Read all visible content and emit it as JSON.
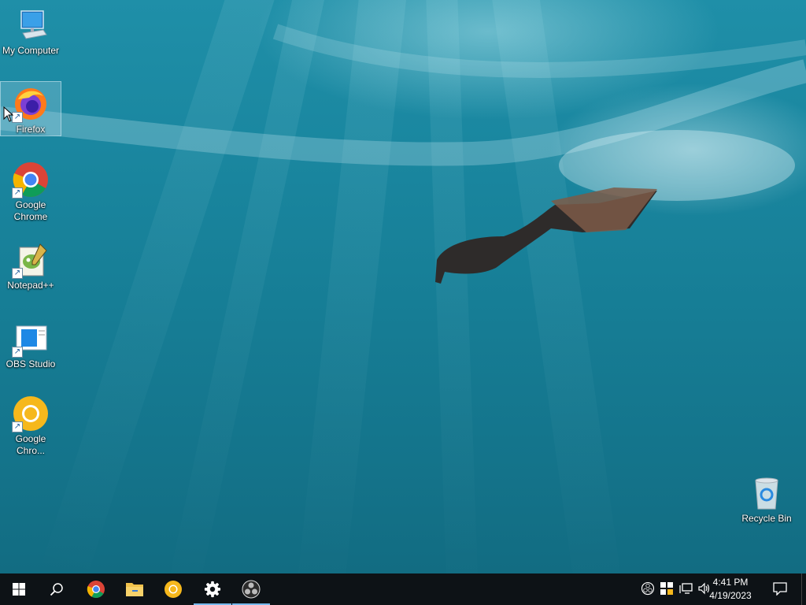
{
  "desktop": {
    "icons": [
      {
        "label": "My Computer"
      },
      {
        "label": "Firefox"
      },
      {
        "label": "Google Chrome"
      },
      {
        "label": "Notepad++"
      },
      {
        "label": "OBS Studio"
      },
      {
        "label": "Google Chro..."
      },
      {
        "label": "Recycle Bin"
      }
    ]
  },
  "taskbar": {
    "buttons": [
      {
        "icon": "windows-start-icon"
      },
      {
        "icon": "search-icon"
      },
      {
        "icon": "chrome-icon"
      },
      {
        "icon": "file-explorer-icon"
      },
      {
        "icon": "chrome-canary-icon"
      },
      {
        "icon": "settings-gear-icon"
      },
      {
        "icon": "obs-studio-icon"
      }
    ],
    "tray": {
      "time": "4:41 PM",
      "date": "4/19/2023"
    }
  },
  "colors": {
    "accent": "#76b9ed",
    "taskbar": "#0d1216"
  }
}
